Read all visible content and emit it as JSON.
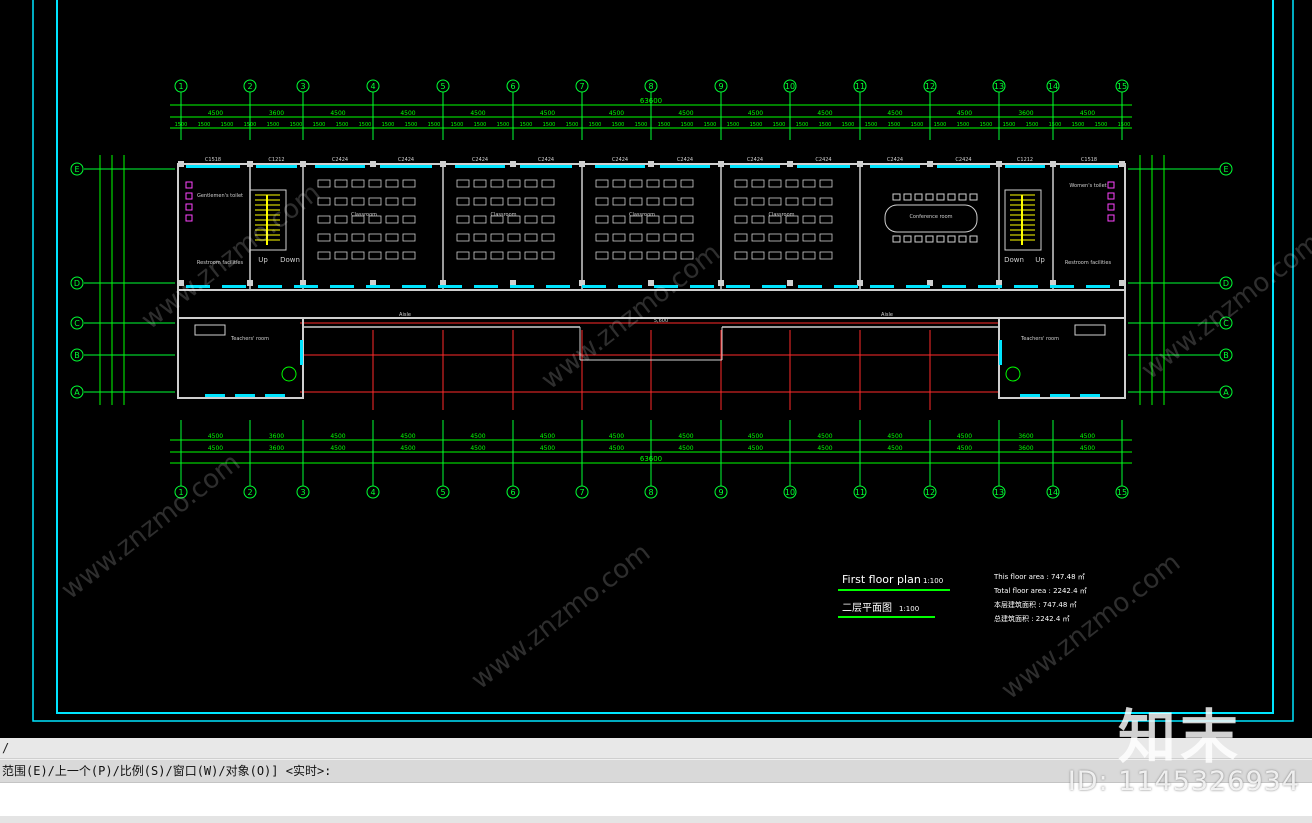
{
  "drawing": {
    "overall_dimension": "63600",
    "axes": [
      "1",
      "2",
      "3",
      "4",
      "5",
      "6",
      "7",
      "8",
      "9",
      "10",
      "11",
      "12",
      "13",
      "14",
      "15"
    ],
    "row_axes": [
      "E",
      "D",
      "C",
      "B",
      "A"
    ],
    "top_dims": [
      "4500",
      "3600",
      "4500",
      "4500",
      "4500",
      "4500",
      "4500",
      "4500",
      "4500",
      "4500",
      "4500",
      "4500",
      "3600",
      "4500"
    ],
    "vertical_dims": [
      "4800",
      "2700",
      "2700",
      "1800",
      "2100",
      "3450",
      "1500",
      "290"
    ],
    "windows_top": [
      "C1518",
      "C1212",
      "C2424",
      "C2424",
      "C2424",
      "C2424",
      "C2424",
      "C2424",
      "C2424",
      "C2424",
      "C2424",
      "C2424",
      "C1212",
      "C1518"
    ],
    "rooms": {
      "gents_toilet": "Gentlemen's toilet",
      "womens_toilet": "Women's toilet",
      "classroom": "Classroom",
      "conference": "Conference room",
      "teachers": "Teachers' room",
      "aisle": "Aisle",
      "restroom": "Restroom facilities",
      "up": "Up",
      "down": "Down"
    },
    "plan_title_en": "First floor plan",
    "plan_scale_en": "1:100",
    "plan_title_cn": "二层平面图",
    "plan_scale_cn": "1:100",
    "area_lines": [
      "This floor area : 747.48 ㎡",
      "Total floor area : 2242.4 ㎡",
      "本层建筑面积 : 747.48 ㎡",
      "总建筑面积 : 2242.4 ㎡"
    ],
    "aisle_dim": "5,600"
  },
  "watermark": {
    "logo_text": "知末",
    "id_text": "ID: 1145326934",
    "url_text": "www.znzmo.com"
  },
  "command": {
    "history_char": "/",
    "prompt_text": "范围(E)/上一个(P)/比例(S)/窗口(W)/对象(O)] <实时>:"
  },
  "colors": {
    "frame": "#00e5ff",
    "dim": "#00ff00",
    "axis": "#00ff33",
    "wall": "#cfcfcf",
    "window": "#00e5ff",
    "red_axis": "#ff2a2a",
    "title_line": "#00ff00",
    "magenta": "#ff44ff",
    "yellow": "#ffff00"
  }
}
